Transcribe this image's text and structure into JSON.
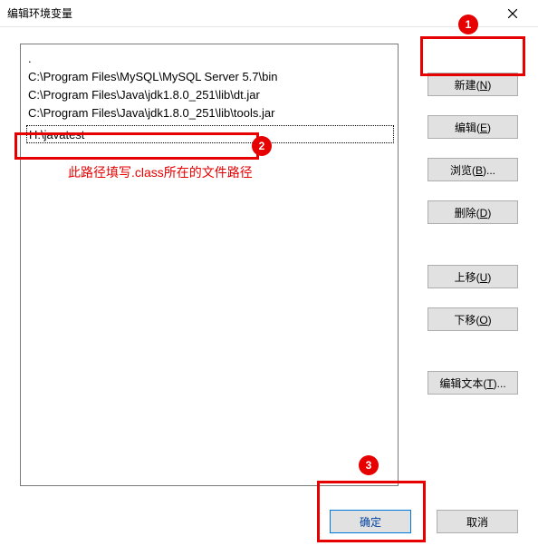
{
  "window": {
    "title": "编辑环境变量"
  },
  "list": {
    "items": [
      ".",
      "C:\\Program Files\\MySQL\\MySQL Server 5.7\\bin",
      "C:\\Program Files\\Java\\jdk1.8.0_251\\lib\\dt.jar",
      "C:\\Program Files\\Java\\jdk1.8.0_251\\lib\\tools.jar"
    ],
    "editing_value": "H:\\javatest"
  },
  "buttons": {
    "new_label": "新建",
    "new_mnemonic": "N",
    "edit_label": "编辑",
    "edit_mnemonic": "E",
    "browse_label": "浏览",
    "browse_mnemonic": "B",
    "delete_label": "删除",
    "delete_mnemonic": "D",
    "up_label": "上移",
    "up_mnemonic": "U",
    "down_label": "下移",
    "down_mnemonic": "O",
    "edit_text_label": "编辑文本",
    "edit_text_mnemonic": "T",
    "ok_label": "确定",
    "cancel_label": "取消"
  },
  "annotations": {
    "badge1": "1",
    "badge2": "2",
    "badge3": "3",
    "hint_text": "此路径填写.class所在的文件路径"
  }
}
